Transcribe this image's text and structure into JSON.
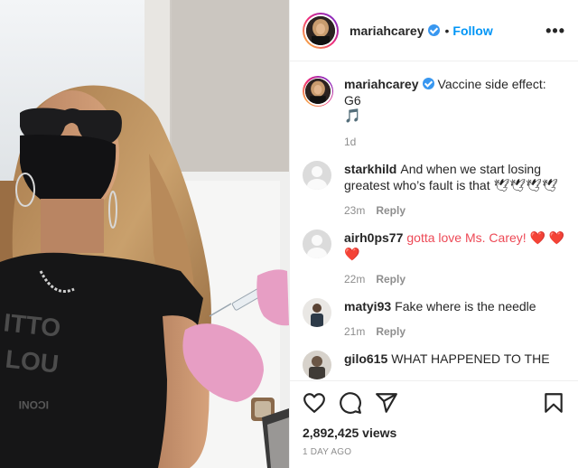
{
  "post": {
    "author": {
      "username": "mariahcarey",
      "verified": true,
      "follow_label": "Follow",
      "separator": "•",
      "more_label": "•••"
    },
    "caption": {
      "username": "mariahcarey",
      "text": "Vaccine side effect: G6",
      "emoji": "🎵",
      "time": "1d"
    },
    "comments": [
      {
        "username": "starkhild",
        "text": "And when we start losing greatest who’s fault is that 🕊🕊🕊🕊",
        "time": "23m",
        "reply_label": "Reply",
        "avatar": "default"
      },
      {
        "username": "airh0ps77",
        "text": "gotta love Ms. Carey! ❤️ ❤️ ❤️",
        "time": "22m",
        "reply_label": "Reply",
        "avatar": "default"
      },
      {
        "username": "matyi93",
        "text": "Fake where is the needle",
        "time": "21m",
        "reply_label": "Reply",
        "avatar": "photo"
      },
      {
        "username": "gilo615",
        "text": "WHAT HAPPENED TO THE",
        "avatar": "photo"
      }
    ],
    "actions": {
      "like_icon": "heart-outline-icon",
      "comment_icon": "comment-bubble-icon",
      "share_icon": "paper-plane-icon",
      "save_icon": "bookmark-icon"
    },
    "views": "2,892,425 views",
    "posted_ago": "1 DAY AGO",
    "shirt_text": [
      "ITTO",
      "LOU",
      "ICONI"
    ]
  },
  "colors": {
    "link_blue": "#0095f6",
    "verified_blue": "#3897f0",
    "heart_red": "#ed4956",
    "meta_gray": "#8e8e8e"
  }
}
